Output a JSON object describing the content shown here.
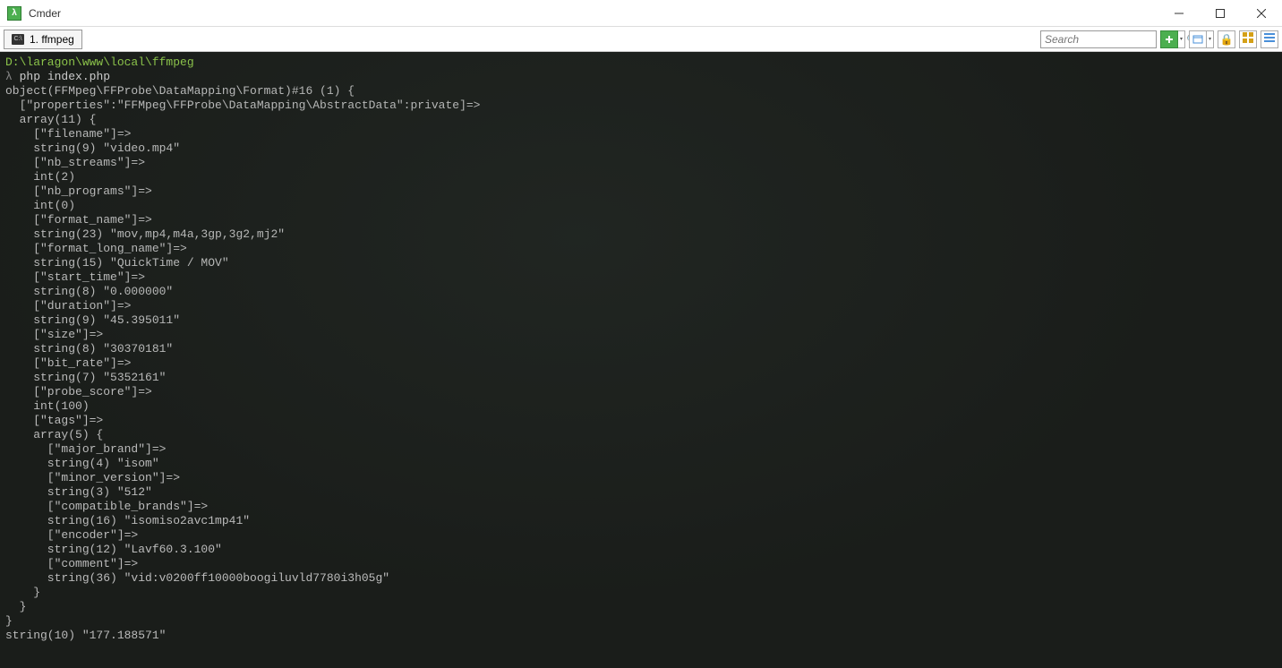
{
  "window": {
    "title": "Cmder",
    "icon_glyph": "λ"
  },
  "tab": {
    "icon_glyph": "C:\\",
    "label": "1. ffmpeg"
  },
  "toolbar": {
    "search_placeholder": "Search"
  },
  "terminal": {
    "cwd": "D:\\laragon\\www\\local\\ffmpeg",
    "prompt_symbol": "λ",
    "command": "php index.php",
    "output_lines": [
      "object(FFMpeg\\FFProbe\\DataMapping\\Format)#16 (1) {",
      "  [\"properties\":\"FFMpeg\\FFProbe\\DataMapping\\AbstractData\":private]=>",
      "  array(11) {",
      "    [\"filename\"]=>",
      "    string(9) \"video.mp4\"",
      "    [\"nb_streams\"]=>",
      "    int(2)",
      "    [\"nb_programs\"]=>",
      "    int(0)",
      "    [\"format_name\"]=>",
      "    string(23) \"mov,mp4,m4a,3gp,3g2,mj2\"",
      "    [\"format_long_name\"]=>",
      "    string(15) \"QuickTime / MOV\"",
      "    [\"start_time\"]=>",
      "    string(8) \"0.000000\"",
      "    [\"duration\"]=>",
      "    string(9) \"45.395011\"",
      "    [\"size\"]=>",
      "    string(8) \"30370181\"",
      "    [\"bit_rate\"]=>",
      "    string(7) \"5352161\"",
      "    [\"probe_score\"]=>",
      "    int(100)",
      "    [\"tags\"]=>",
      "    array(5) {",
      "      [\"major_brand\"]=>",
      "      string(4) \"isom\"",
      "      [\"minor_version\"]=>",
      "      string(3) \"512\"",
      "      [\"compatible_brands\"]=>",
      "      string(16) \"isomiso2avc1mp41\"",
      "      [\"encoder\"]=>",
      "      string(12) \"Lavf60.3.100\"",
      "      [\"comment\"]=>",
      "      string(36) \"vid:v0200ff10000boogiluvld7780i3h05g\"",
      "    }",
      "  }",
      "}",
      "string(10) \"177.188571\""
    ]
  }
}
